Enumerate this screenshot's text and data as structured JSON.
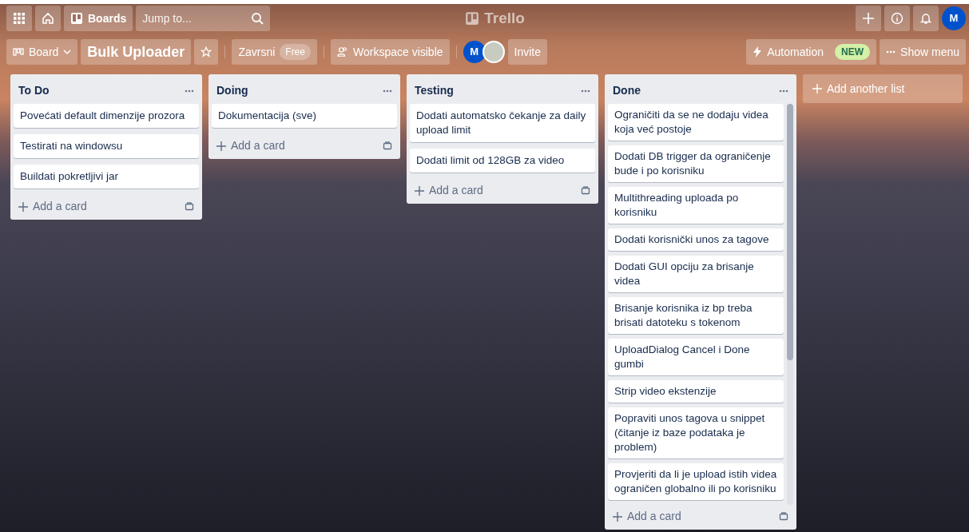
{
  "header": {
    "boards_label": "Boards",
    "search": {
      "placeholder": "Jump to..."
    },
    "logo": "Trello",
    "avatar": "M"
  },
  "board_bar": {
    "view": "Board",
    "title": "Bulk Uploader",
    "workspace": "Zavrsni",
    "plan": "Free",
    "visibility": "Workspace visible",
    "members": [
      {
        "kind": "initial",
        "initial": "M"
      },
      {
        "kind": "photo"
      }
    ],
    "invite": "Invite",
    "automation": "Automation",
    "automation_badge": "NEW",
    "show_menu": "Show menu"
  },
  "lists": [
    {
      "title": "To Do",
      "cards": [
        "Povećati default dimenzije prozora",
        "Testirati na windowsu",
        "Buildati pokretljivi jar"
      ],
      "add_label": "Add a card"
    },
    {
      "title": "Doing",
      "cards": [
        "Dokumentacija (sve)"
      ],
      "add_label": "Add a card"
    },
    {
      "title": "Testing",
      "cards": [
        "Dodati automatsko čekanje za daily upload limit",
        "Dodati limit od 128GB za video"
      ],
      "add_label": "Add a card"
    },
    {
      "title": "Done",
      "cards": [
        "Ograničiti da se ne dodaju videa koja već postoje",
        "Dodati DB trigger da ograničenje bude i po korisniku",
        "Multithreading uploada po korisniku",
        "Dodati korisnički unos za tagove",
        "Dodati GUI opciju za brisanje videa",
        "Brisanje korisnika iz bp treba brisati datoteku s tokenom",
        "UploadDialog Cancel i Done gumbi",
        "Strip video ekstenzije",
        "Popraviti unos tagova u snippet (čitanje iz baze podataka je problem)",
        "Provjeriti da li je upload istih videa ograničen globalno ili po korisniku"
      ],
      "add_label": "Add a card"
    }
  ],
  "add_list": "Add another list"
}
